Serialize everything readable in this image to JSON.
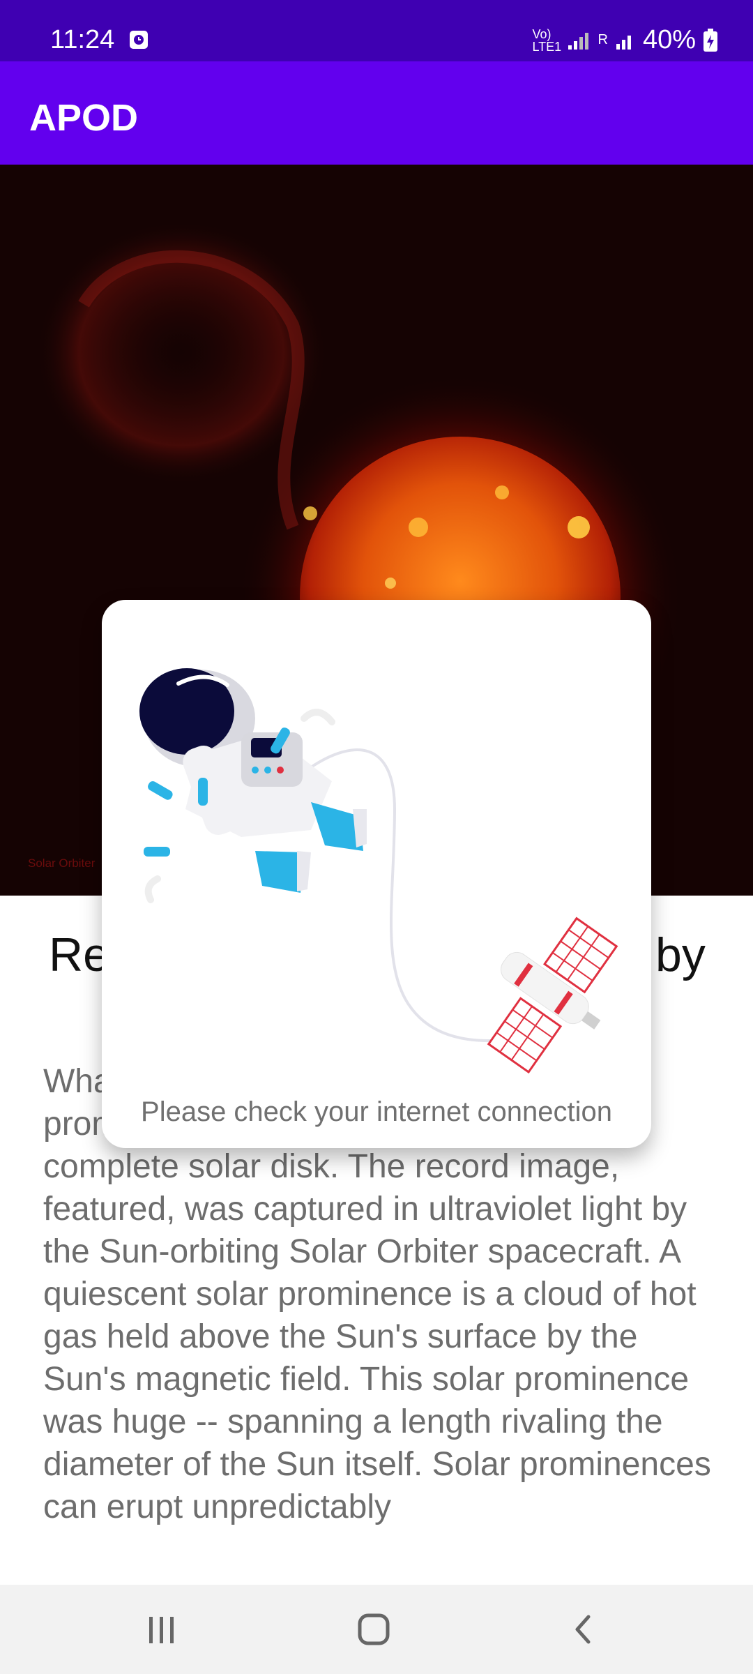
{
  "status_bar": {
    "time": "11:24",
    "network_label": "Vo) LTE1",
    "signal_label": "R",
    "battery": "40%"
  },
  "app_bar": {
    "title": "APOD"
  },
  "hero": {
    "credit": "Solar Orbiter"
  },
  "article": {
    "title_left": "Re",
    "title_right": "by",
    "body": "What may be the most impressive solar prominence ever imaged together with a complete solar disk. The record image, featured, was captured in ultraviolet light by the Sun-orbiting Solar Orbiter spacecraft. A quiescent solar prominence is a cloud of hot gas held above the Sun's surface by the Sun's magnetic field.  This solar prominence was huge -- spanning a length rivaling the diameter of the Sun itself. Solar prominences can erupt unpredictably"
  },
  "dialog": {
    "message": "Please check your internet connection"
  },
  "icons": {
    "clock": "clock-icon",
    "signal": "signal-icon",
    "battery": "battery-charging-icon",
    "recents": "recents-icon",
    "home": "home-icon",
    "back": "back-icon",
    "astronaut": "astronaut-icon",
    "satellite": "satellite-icon"
  }
}
